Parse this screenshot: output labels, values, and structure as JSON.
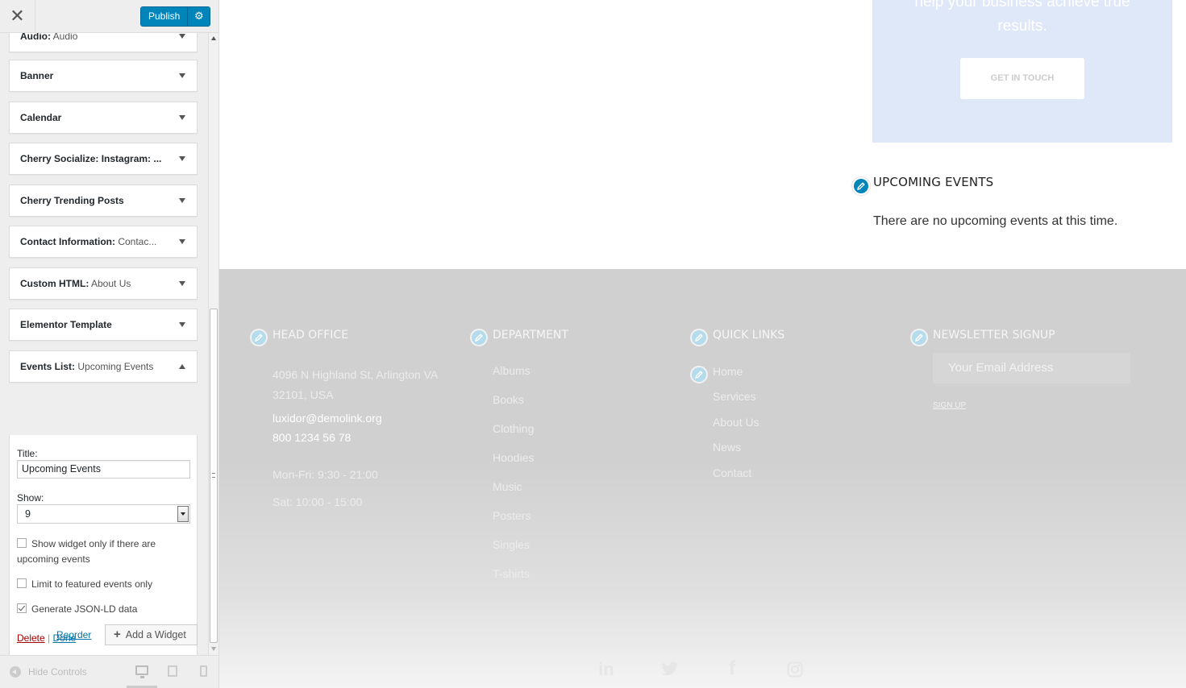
{
  "sidebar": {
    "close_label": "✕",
    "publish_label": "Publish",
    "widgets": [
      {
        "title": "Audio:",
        "subtitle": " Audio"
      },
      {
        "title": "Banner",
        "subtitle": ""
      },
      {
        "title": "Calendar",
        "subtitle": ""
      },
      {
        "title": "Cherry Socialize: Instagram: ...",
        "subtitle": ""
      },
      {
        "title": "Cherry Trending Posts",
        "subtitle": ""
      },
      {
        "title": "Contact Information:",
        "subtitle": " Contac..."
      },
      {
        "title": "Custom HTML:",
        "subtitle": " About Us"
      },
      {
        "title": "Elementor Template",
        "subtitle": ""
      },
      {
        "title": "Events List:",
        "subtitle": " Upcoming Events"
      }
    ],
    "form": {
      "title_label": "Title:",
      "title_value": "Upcoming Events",
      "show_label": "Show:",
      "show_value": "9",
      "checkboxes": [
        {
          "label": "Show widget only if there are upcoming events",
          "checked": false
        },
        {
          "label": "Limit to featured events only",
          "checked": false
        },
        {
          "label": "Generate JSON-LD data",
          "checked": true
        }
      ],
      "delete_label": "Delete",
      "separator": " | ",
      "done_label": "Done"
    },
    "reorder_label": "Reorder",
    "add_widget_label": "Add a Widget",
    "hide_controls_label": "Hide Controls"
  },
  "preview": {
    "cta_text": "help your business achieve true",
    "cta_text2": "results.",
    "cta_button": "GET IN TOUCH",
    "upcoming_title": "UPCOMING EVENTS",
    "upcoming_msg": "There are no upcoming events at this time.",
    "footer": {
      "head_office": {
        "title": "HEAD OFFICE",
        "address1": "4096 N Highland St, Arlington VA",
        "address2": "32101, USA",
        "email": "luxidor@demolink.org",
        "phone": "800 1234 56 78",
        "hours1": "Mon-Fri: 9:30 - 21:00",
        "hours2": "Sat: 10:00 - 15:00"
      },
      "department": {
        "title": "DEPARTMENT",
        "items": [
          "Albums",
          "Books",
          "Clothing",
          "Hoodies",
          "Music",
          "Posters",
          "Singles",
          "T-shirts"
        ]
      },
      "quick_links": {
        "title": "QUICK LINKS",
        "items": [
          "Home",
          "Services",
          "About Us",
          "News",
          "Contact"
        ]
      },
      "newsletter": {
        "title": "NEWSLETTER SIGNUP",
        "placeholder": "Your Email Address",
        "signup": "SIGN UP"
      },
      "social_labels": {
        "linkedin": "in",
        "facebook": "f"
      }
    }
  }
}
